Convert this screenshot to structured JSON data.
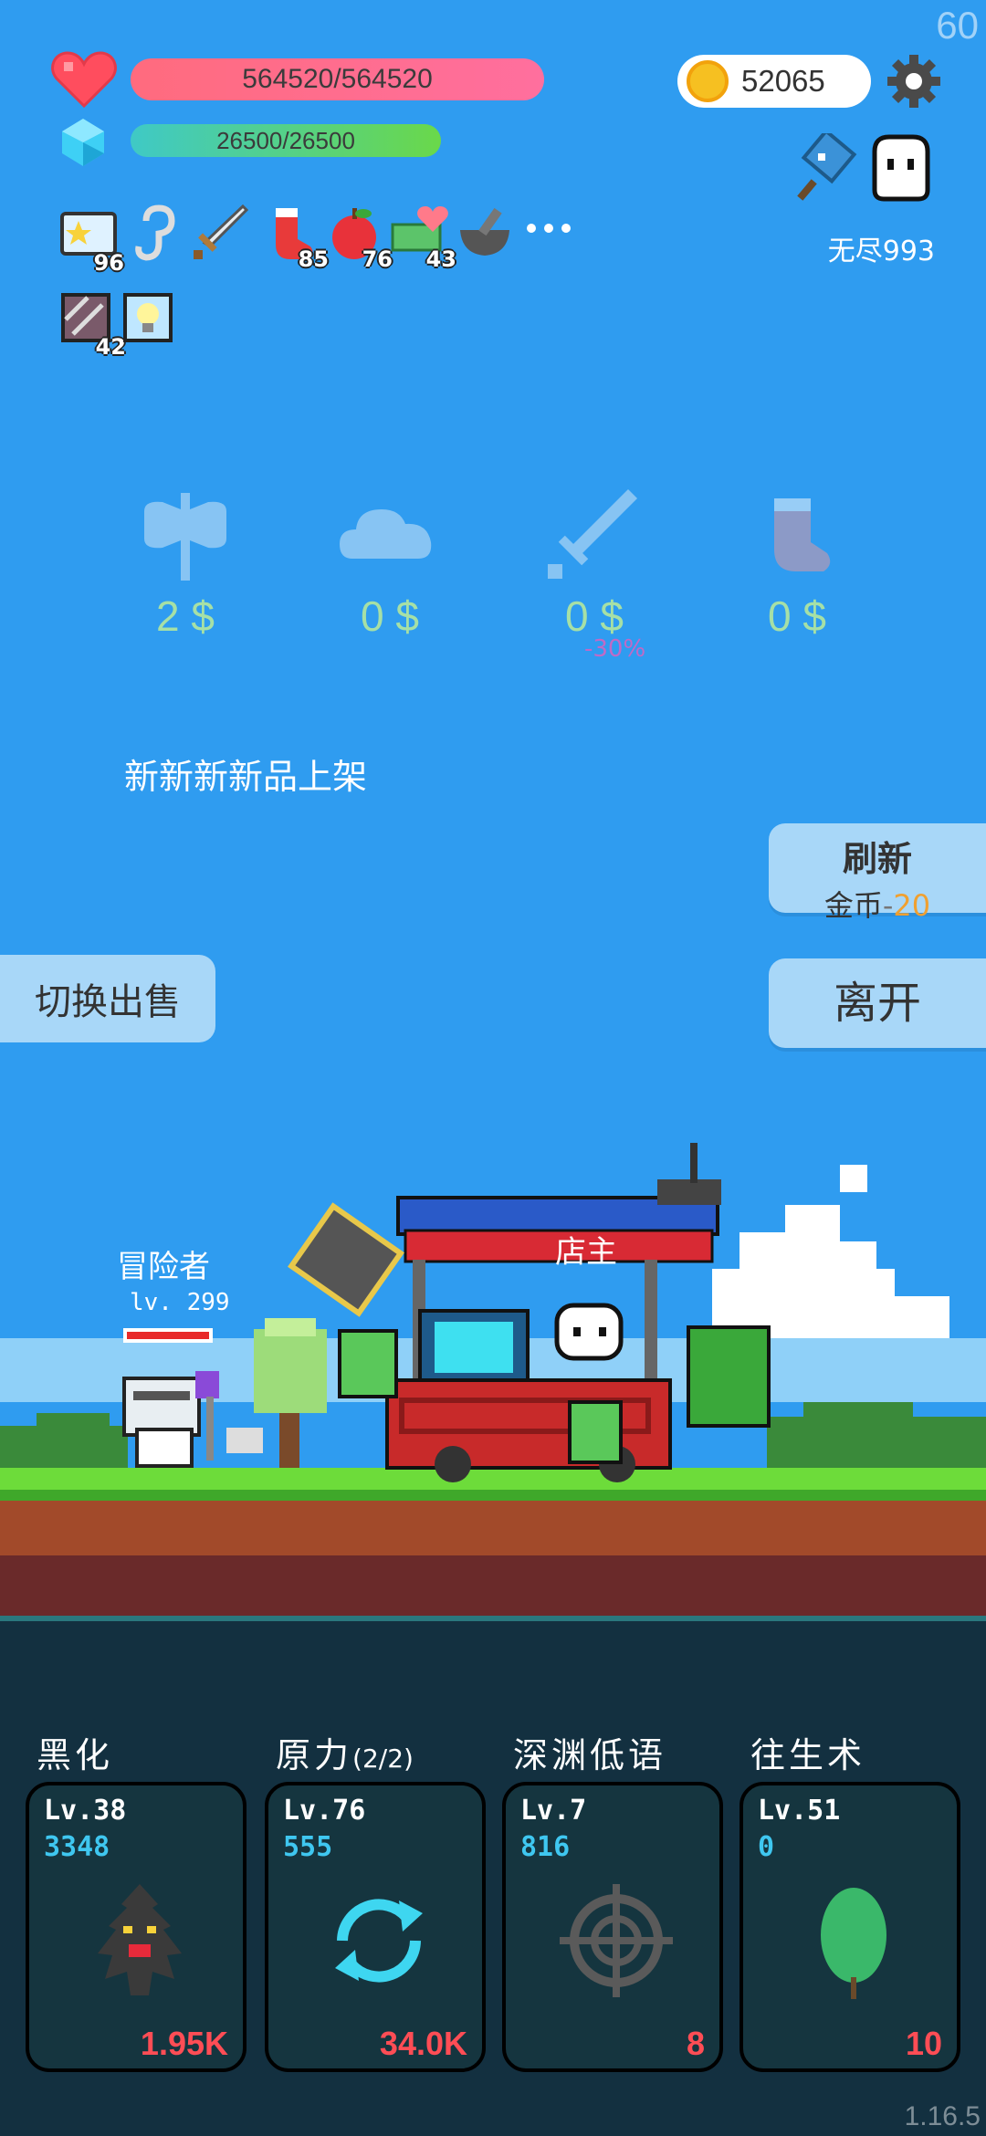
{
  "fps": "60",
  "player": {
    "hp_text": "564520/564520",
    "mp_text": "26500/26500",
    "gold": "52065"
  },
  "mode": {
    "label": "无尽993"
  },
  "inventory": [
    {
      "icon": "star-card-icon",
      "count": "96"
    },
    {
      "icon": "hook-icon",
      "count": ""
    },
    {
      "icon": "sword-icon",
      "count": ""
    },
    {
      "icon": "sock-icon",
      "count": "85"
    },
    {
      "icon": "apple-icon",
      "count": "76"
    },
    {
      "icon": "money-heart-icon",
      "count": "43"
    },
    {
      "icon": "mortar-icon",
      "count": ""
    },
    {
      "icon": "more-icon",
      "count": ""
    },
    {
      "icon": "striped-card-icon",
      "count": "42"
    },
    {
      "icon": "light-bulb-icon",
      "count": ""
    }
  ],
  "shop": {
    "items": [
      {
        "icon": "axe-icon",
        "price": "2 $",
        "discount": ""
      },
      {
        "icon": "cloud-icon",
        "price": "0 $",
        "discount": ""
      },
      {
        "icon": "sword-icon",
        "price": "0 $",
        "discount": "-30%"
      },
      {
        "icon": "sock-icon",
        "price": "0 $",
        "discount": ""
      }
    ],
    "notice": "新新新新品上架",
    "refresh_title": "刷新",
    "refresh_cost_label": "金币",
    "refresh_cost_sep": "-",
    "refresh_cost_value": "20",
    "leave_label": "离开",
    "switch_label": "切换出售"
  },
  "scene": {
    "adventurer_label": "冒险者",
    "adventurer_level": "lv. 299",
    "shop_sign": "店主"
  },
  "skills": [
    {
      "name": "黑化",
      "suffix": "",
      "level": "Lv.38",
      "value": "3348",
      "cost": "1.95K",
      "icon": "dark-tree-icon"
    },
    {
      "name": "原力",
      "suffix": "(2/2)",
      "level": "Lv.76",
      "value": "555",
      "cost": "34.0K",
      "icon": "cycle-arrows-icon"
    },
    {
      "name": "深渊低语",
      "suffix": "",
      "level": "Lv.7",
      "value": "816",
      "cost": "8",
      "icon": "crosshair-icon"
    },
    {
      "name": "往生术",
      "suffix": "",
      "level": "Lv.51",
      "value": "0",
      "cost": "10",
      "icon": "leaf-icon"
    }
  ],
  "version": "1.16.5",
  "colors": {
    "sky": "#2f9cf0",
    "hp": "#ff6b7e",
    "mp": "#3fc9c6",
    "skill_value": "#3fc7f0",
    "skill_cost": "#ff4d55",
    "refresh_cost": "#f0a030"
  }
}
